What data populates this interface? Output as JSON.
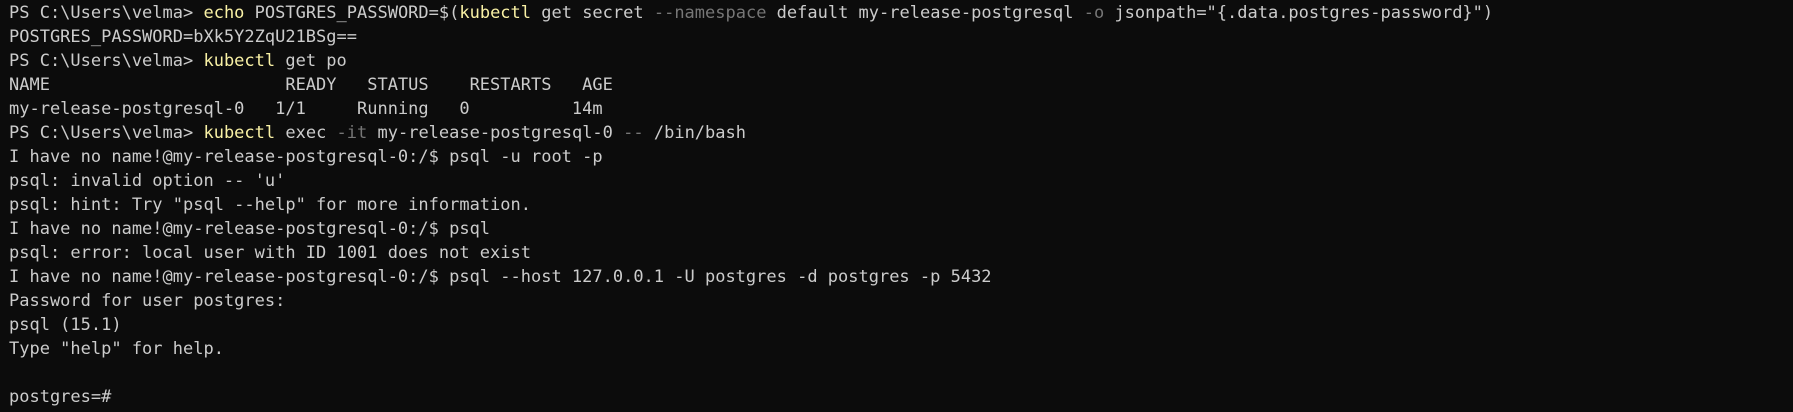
{
  "colors": {
    "background": "#0c0c0c",
    "text": "#cccccc",
    "command": "#f9f1a5",
    "parameter": "#767676"
  },
  "lines": [
    [
      {
        "t": "text",
        "v": "PS C:\\Users\\velma> "
      },
      {
        "t": "cmd",
        "v": "echo"
      },
      {
        "t": "text",
        "v": " POSTGRES_PASSWORD=$("
      },
      {
        "t": "cmd",
        "v": "kubectl"
      },
      {
        "t": "text",
        "v": " get secret "
      },
      {
        "t": "param",
        "v": "--namespace"
      },
      {
        "t": "text",
        "v": " default my-release-postgresql "
      },
      {
        "t": "param",
        "v": "-o"
      },
      {
        "t": "text",
        "v": " jsonpath=\"{.data.postgres-password}\")"
      }
    ],
    [
      {
        "t": "text",
        "v": "POSTGRES_PASSWORD=bXk5Y2ZqU21BSg=="
      }
    ],
    [
      {
        "t": "text",
        "v": "PS C:\\Users\\velma> "
      },
      {
        "t": "cmd",
        "v": "kubectl"
      },
      {
        "t": "text",
        "v": " get po"
      }
    ],
    [
      {
        "t": "text",
        "v": "NAME                       READY   STATUS    RESTARTS   AGE"
      }
    ],
    [
      {
        "t": "text",
        "v": "my-release-postgresql-0   1/1     Running   0          14m"
      }
    ],
    [
      {
        "t": "text",
        "v": "PS C:\\Users\\velma> "
      },
      {
        "t": "cmd",
        "v": "kubectl"
      },
      {
        "t": "text",
        "v": " exec "
      },
      {
        "t": "param",
        "v": "-it"
      },
      {
        "t": "text",
        "v": " my-release-postgresql-0 "
      },
      {
        "t": "param",
        "v": "--"
      },
      {
        "t": "text",
        "v": " /bin/bash"
      }
    ],
    [
      {
        "t": "text",
        "v": "I have no name!@my-release-postgresql-0:/$ psql -u root -p"
      }
    ],
    [
      {
        "t": "text",
        "v": "psql: invalid option -- 'u'"
      }
    ],
    [
      {
        "t": "text",
        "v": "psql: hint: Try \"psql --help\" for more information."
      }
    ],
    [
      {
        "t": "text",
        "v": "I have no name!@my-release-postgresql-0:/$ psql"
      }
    ],
    [
      {
        "t": "text",
        "v": "psql: error: local user with ID 1001 does not exist"
      }
    ],
    [
      {
        "t": "text",
        "v": "I have no name!@my-release-postgresql-0:/$ psql --host 127.0.0.1 -U postgres -d postgres -p 5432"
      }
    ],
    [
      {
        "t": "text",
        "v": "Password for user postgres:"
      }
    ],
    [
      {
        "t": "text",
        "v": "psql (15.1)"
      }
    ],
    [
      {
        "t": "text",
        "v": "Type \"help\" for help."
      }
    ],
    [],
    [
      {
        "t": "text",
        "v": "postgres=#"
      }
    ]
  ]
}
